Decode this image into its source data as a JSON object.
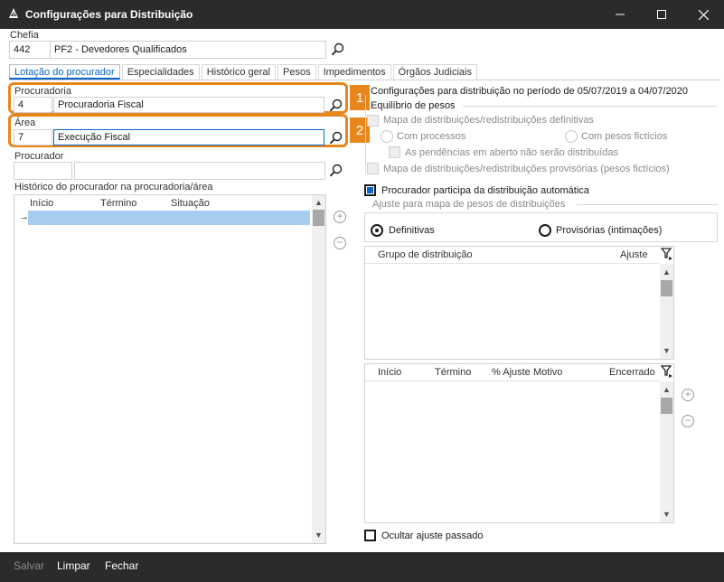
{
  "window": {
    "title": "Configurações para Distribuição"
  },
  "chefia": {
    "label": "Chefia",
    "code": "442",
    "name": "PF2 - Devedores Qualificados"
  },
  "tabs": [
    {
      "label": "Lotação do procurador",
      "active": true
    },
    {
      "label": "Especialidades"
    },
    {
      "label": "Histórico geral"
    },
    {
      "label": "Pesos"
    },
    {
      "label": "Impedimentos"
    },
    {
      "label": "Órgãos Judiciais"
    }
  ],
  "procuradoria": {
    "label": "Procuradoria",
    "code": "4",
    "name": "Procuradoria Fiscal",
    "badge": "1"
  },
  "area": {
    "label": "Área",
    "code": "7",
    "name": "Execução Fiscal",
    "badge": "2"
  },
  "procurador": {
    "label": "Procurador",
    "code": "",
    "name": ""
  },
  "historico": {
    "label": "Histórico do procurador na procuradoria/área",
    "columns": [
      "Início",
      "Término",
      "Situação"
    ],
    "row_marker": "→"
  },
  "config": {
    "period": "Configurações para distribuição no período de 05/07/2019 a 04/07/2020",
    "equilibrio_label": "Equilíbrio de pesos",
    "mapa_definitivas": "Mapa de distribuições/redistribuições definitivas",
    "com_processos": "Com processos",
    "com_pesos_ficticios": "Com pesos fictícios",
    "pendencias": "As pendências em aberto não serão distribuídas",
    "mapa_provisorias": "Mapa de distribuições/redistribuições provisórias (pesos fictícios)",
    "participa": "Procurador participa da distribuição automática",
    "participa_checked": true,
    "ajuste_label": "Ajuste para mapa de pesos de distribuições",
    "radio_definitivas": "Definitivas",
    "radio_provisorias": "Provisórias (intimações)",
    "selected": "Definitivas"
  },
  "grupo_grid": {
    "columns": [
      "Grupo de distribuição",
      "Ajuste"
    ]
  },
  "ajuste_grid": {
    "columns": [
      "Início",
      "Término",
      "% Ajuste",
      "Motivo",
      "Encerrado"
    ]
  },
  "ocultar": {
    "label": "Ocultar ajuste passado",
    "checked": false
  },
  "footer": {
    "salvar": "Salvar",
    "limpar": "Limpar",
    "fechar": "Fechar"
  },
  "colors": {
    "titlebar": "#2b2b2b",
    "accent": "#0a64c8",
    "highlight": "#e8861e",
    "selected_row": "#a6cdf0"
  }
}
